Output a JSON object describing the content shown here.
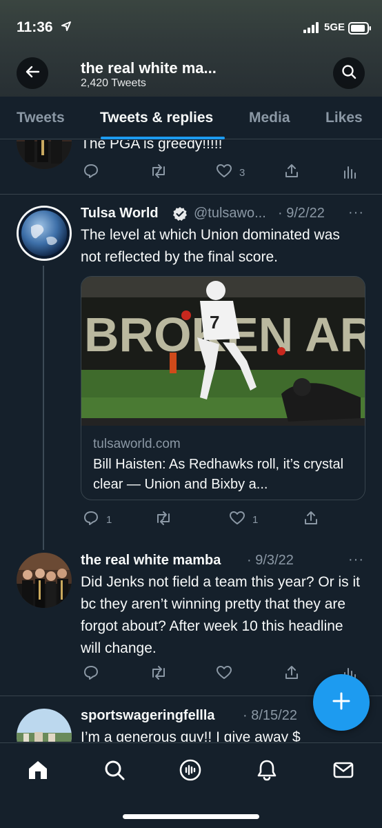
{
  "status_bar": {
    "time": "11:36",
    "network": "5GE"
  },
  "header": {
    "title": "the real white ma...",
    "subtitle": "2,420 Tweets",
    "back_icon": "arrow-left-icon",
    "search_icon": "search-icon"
  },
  "tabs": [
    {
      "label": "Tweets"
    },
    {
      "label": "Tweets & replies",
      "active": true
    },
    {
      "label": "Media"
    },
    {
      "label": "Likes"
    }
  ],
  "tweets": [
    {
      "text": "The PGA is greedy!!!!!",
      "like_count": "3"
    },
    {
      "name": "Tulsa World",
      "verified": true,
      "handle": "@tulsawo...",
      "date": "· 9/2/22",
      "text": "The level at which Union dominated was not reflected by the final score.",
      "card": {
        "domain": "tulsaworld.com",
        "title": "Bill Haisten: As Redhawks roll, it’s crystal clear — Union and Bixby a..."
      },
      "reply_count": "1",
      "like_count": "1"
    },
    {
      "name": "the real white mamba",
      "date": "· 9/3/22",
      "text": "Did Jenks not field a team this year? Or is it bc they aren’t winning pretty that they are forgot about? After week 10 this headline will change."
    },
    {
      "name": "sportswageringfellla",
      "date": "· 8/15/22",
      "text": "I’m a generous guy!! I give away $"
    }
  ],
  "more_label": "···",
  "colors": {
    "accent": "#1d9bf0",
    "background": "#15202b",
    "muted": "#8b98a5",
    "divider": "#38444d"
  },
  "nav": [
    "home-icon",
    "search-icon",
    "spaces-icon",
    "notifications-icon",
    "messages-icon"
  ]
}
